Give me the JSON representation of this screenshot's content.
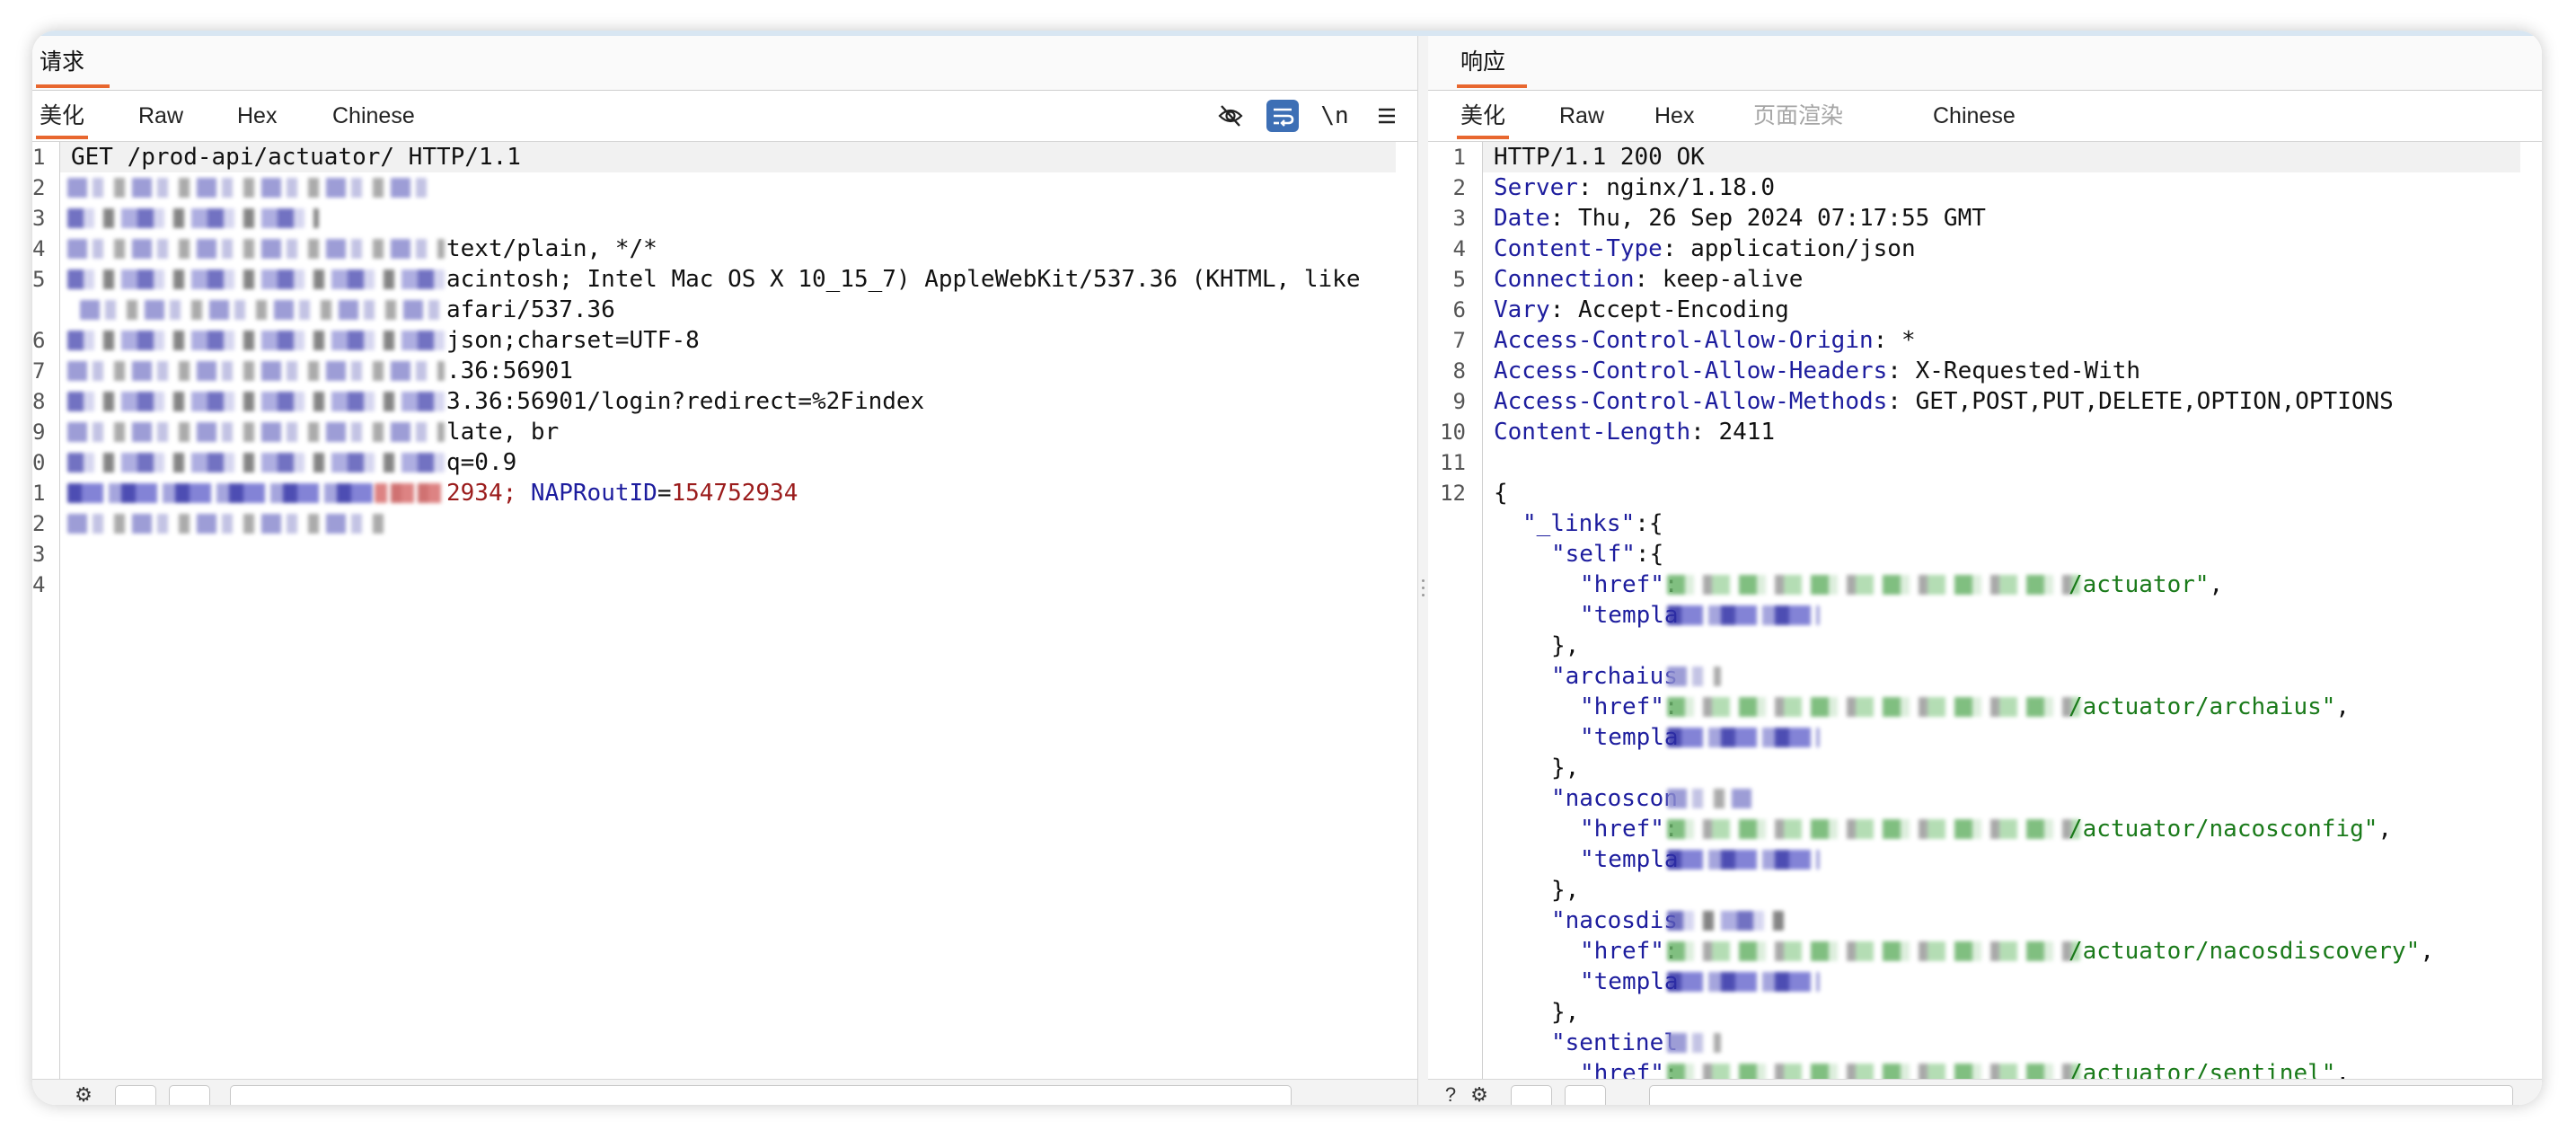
{
  "request": {
    "title": "请求",
    "tabs": [
      {
        "label": "美化",
        "active": true
      },
      {
        "label": "Raw"
      },
      {
        "label": "Hex"
      },
      {
        "label": "Chinese"
      }
    ],
    "tools": {
      "hide_icon": "eye-slash-icon",
      "wrap_icon": "wrap-text-icon",
      "newline_label": "\\n",
      "menu_icon": "menu-icon"
    },
    "line_numbers": [
      "1",
      "2",
      "3",
      "4",
      "5",
      "",
      "6",
      "7",
      "8",
      "9",
      "0",
      "1",
      "2",
      "3",
      "4"
    ],
    "lines": [
      {
        "text": "GET /prod-api/actuator/ HTTP/1.1"
      },
      {
        "text": ""
      },
      {
        "text": ""
      },
      {
        "text": "text/plain, */*"
      },
      {
        "text": "acintosh; Intel Mac OS X 10_15_7) AppleWebKit/537.36 (KHTML, like"
      },
      {
        "text": "afari/537.36"
      },
      {
        "text": "json;charset=UTF-8"
      },
      {
        "text": ".36:56901"
      },
      {
        "text": "3.36:56901/login?redirect=%2Findex"
      },
      {
        "text": "late, br"
      },
      {
        "text": "q=0.9"
      },
      {
        "text_a": "2934; ",
        "key": "NAPRoutID",
        "eq": "=",
        "val": "154752934"
      },
      {
        "text": ""
      },
      {
        "text": ""
      },
      {
        "text": ""
      }
    ]
  },
  "response": {
    "title": "响应",
    "tabs": [
      {
        "label": "美化",
        "active": true
      },
      {
        "label": "Raw"
      },
      {
        "label": "Hex"
      },
      {
        "label": "页面渲染",
        "disabled": true
      },
      {
        "label": "Chinese"
      }
    ],
    "status_line": "HTTP/1.1 200 OK",
    "headers": [
      {
        "name": "Server",
        "value": "nginx/1.18.0"
      },
      {
        "name": "Date",
        "value": "Thu, 26 Sep 2024 07:17:55 GMT"
      },
      {
        "name": "Content-Type",
        "value": "application/json"
      },
      {
        "name": "Connection",
        "value": "keep-alive"
      },
      {
        "name": "Vary",
        "value": "Accept-Encoding"
      },
      {
        "name": "Access-Control-Allow-Origin",
        "value": "*"
      },
      {
        "name": "Access-Control-Allow-Headers",
        "value": "X-Requested-With"
      },
      {
        "name": "Access-Control-Allow-Methods",
        "value": "GET,POST,PUT,DELETE,OPTION,OPTIONS"
      },
      {
        "name": "Content-Length",
        "value": "2411"
      }
    ],
    "line_numbers": [
      "1",
      "2",
      "3",
      "4",
      "5",
      "6",
      "7",
      "8",
      "9",
      "10",
      "11",
      "12"
    ],
    "body": {
      "open": "{",
      "links_key": "\"_links\"",
      "links_open": ":{",
      "entries": [
        {
          "key": "\"self\"",
          "key_suffix": ":{",
          "href_key": "\"href\"",
          "href_tail": "/actuator\"",
          "templa": "\"templa"
        },
        {
          "key": "\"archaius",
          "key_suffix": "",
          "href_key": "\"href\"",
          "href_tail": "/actuator/archaius\"",
          "templa": "\"templa"
        },
        {
          "key": "\"nacoscon",
          "key_suffix": "",
          "href_key": "\"href\"",
          "href_tail": "/actuator/nacosconfig\"",
          "templa": "\"templa"
        },
        {
          "key": "\"nacosdis",
          "key_suffix": "",
          "href_key": "\"href\"",
          "href_tail": "/actuator/nacosdiscovery\"",
          "templa": "\"templa"
        },
        {
          "key": "\"sentinel",
          "key_suffix": "",
          "href_key": "\"href\"",
          "href_tail": "/actuator/sentinel\"",
          "templa": ""
        }
      ],
      "close": "},",
      "comma": ","
    }
  }
}
